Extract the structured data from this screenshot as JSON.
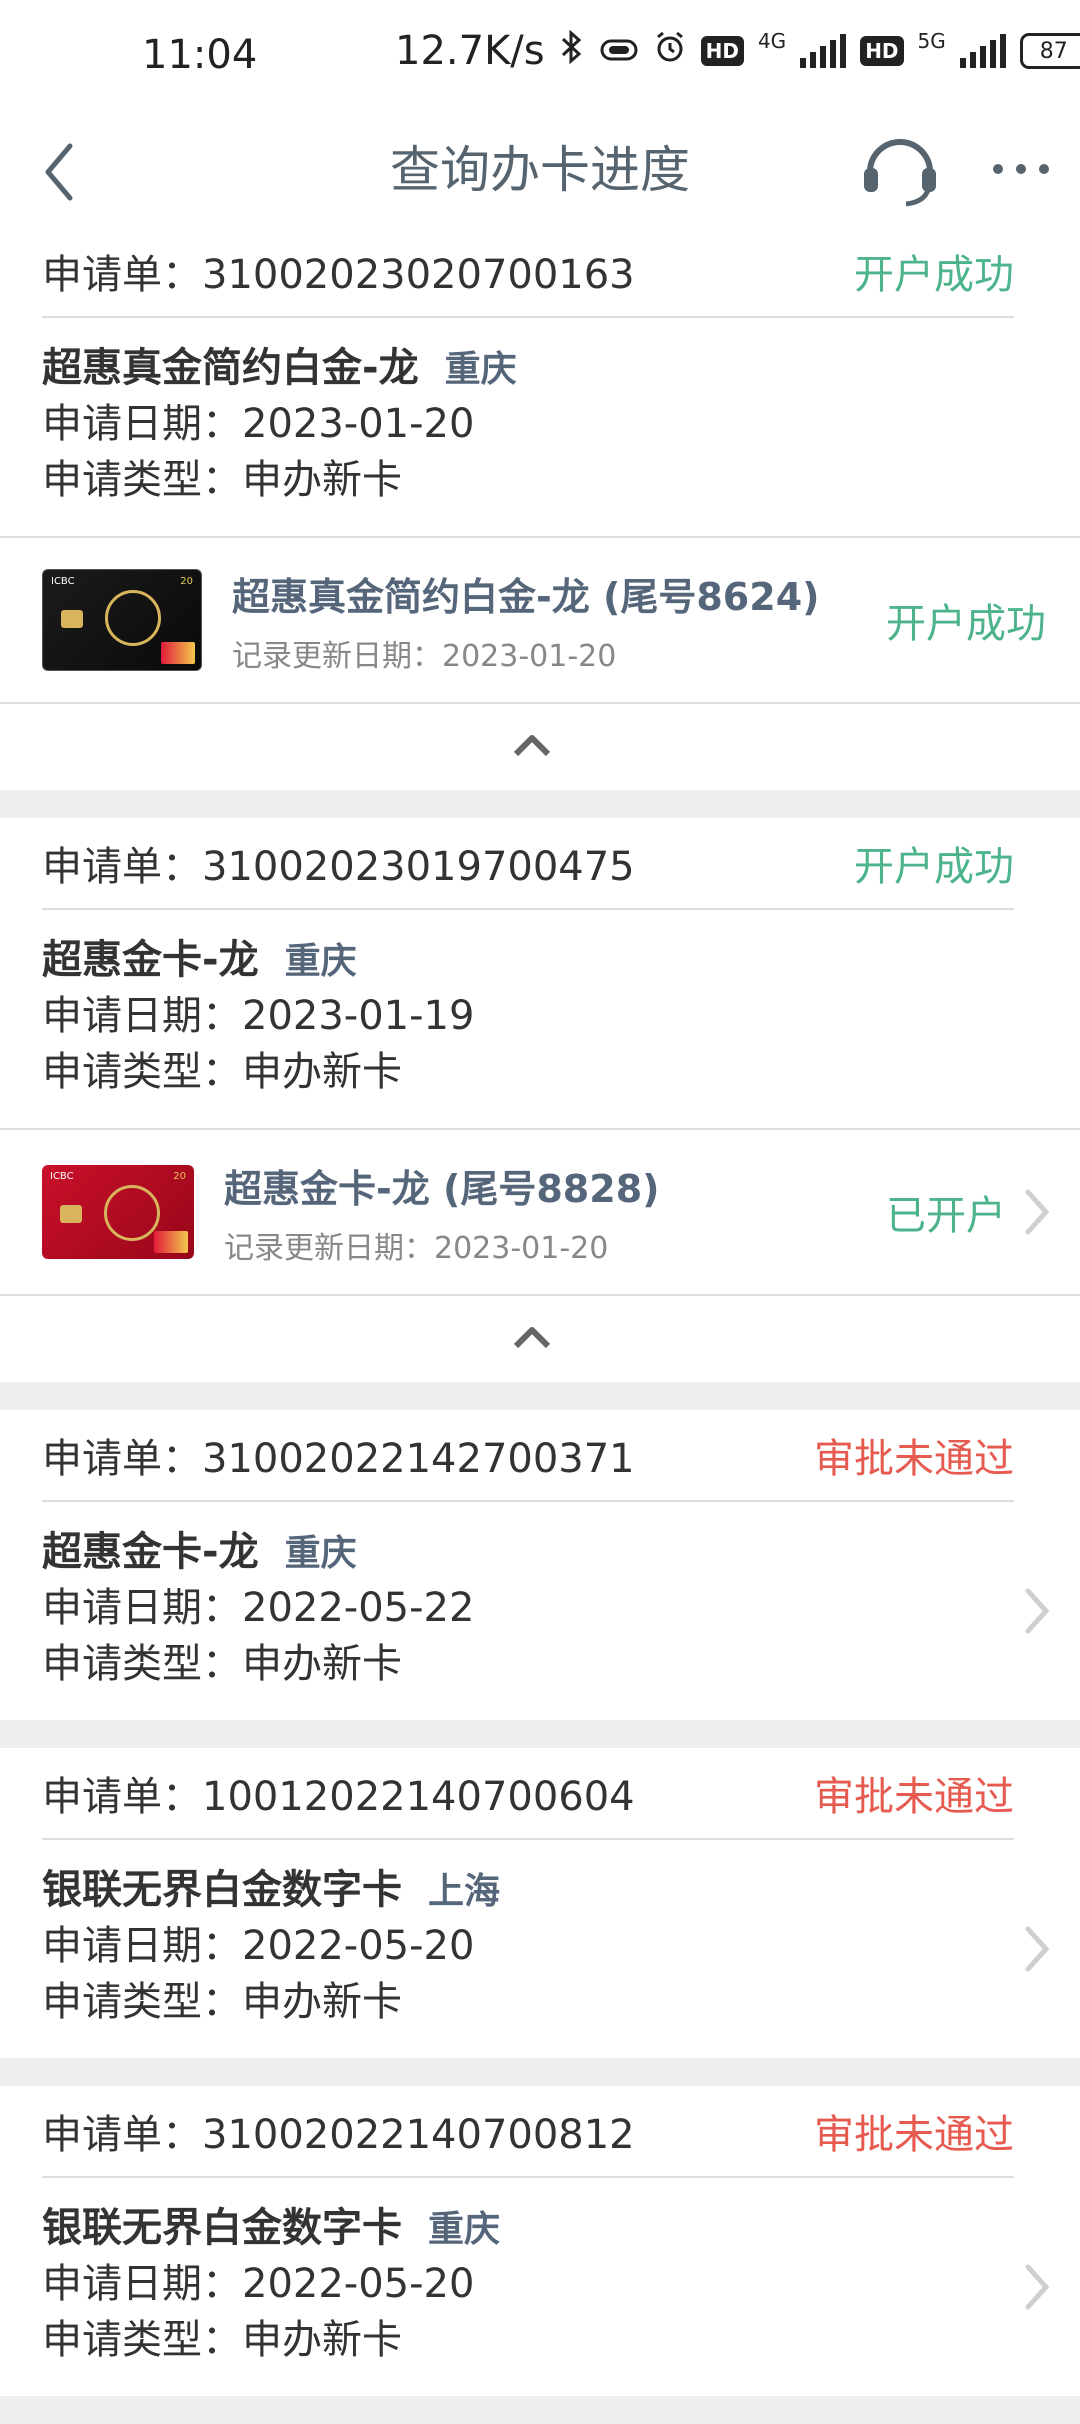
{
  "status_bar": {
    "time": "11:04",
    "speed": "12.7K/s",
    "net1": "4G",
    "net2": "5G",
    "hd": "HD",
    "battery": "87"
  },
  "nav": {
    "title": "查询办卡进度"
  },
  "colors": {
    "success": "#4db38b",
    "fail": "#e65a4f",
    "title": "#56646f"
  },
  "applications": [
    {
      "req_label": "申请单：3100202302070 0163",
      "req": "申请单：31002023020700163",
      "status": "开户成功",
      "product": "超惠真金简约白金-龙",
      "region": "重庆",
      "date": "申请日期：2023-01-20",
      "type": "申请类型：申办新卡",
      "card": {
        "name": "超惠真金简约白金-龙 (尾号8624)",
        "updated": "记录更新日期：2023-01-20",
        "status": "开户成功"
      }
    },
    {
      "req": "申请单：31002023019700475",
      "status": "开户成功",
      "product": "超惠金卡-龙",
      "region": "重庆",
      "date": "申请日期：2023-01-19",
      "type": "申请类型：申办新卡",
      "card": {
        "name": "超惠金卡-龙 (尾号8828)",
        "updated": "记录更新日期：2023-01-20",
        "status": "已开户"
      }
    },
    {
      "req": "申请单：31002022142700371",
      "status": "审批未通过",
      "product": "超惠金卡-龙",
      "region": "重庆",
      "date": "申请日期：2022-05-22",
      "type": "申请类型：申办新卡"
    },
    {
      "req": "申请单：10012022140700604",
      "status": "审批未通过",
      "product": "银联无界白金数字卡",
      "region": "上海",
      "date": "申请日期：2022-05-20",
      "type": "申请类型：申办新卡"
    },
    {
      "req": "申请单：31002022140700812",
      "status": "审批未通过",
      "product": "银联无界白金数字卡",
      "region": "重庆",
      "date": "申请日期：2022-05-20",
      "type": "申请类型：申办新卡"
    }
  ]
}
